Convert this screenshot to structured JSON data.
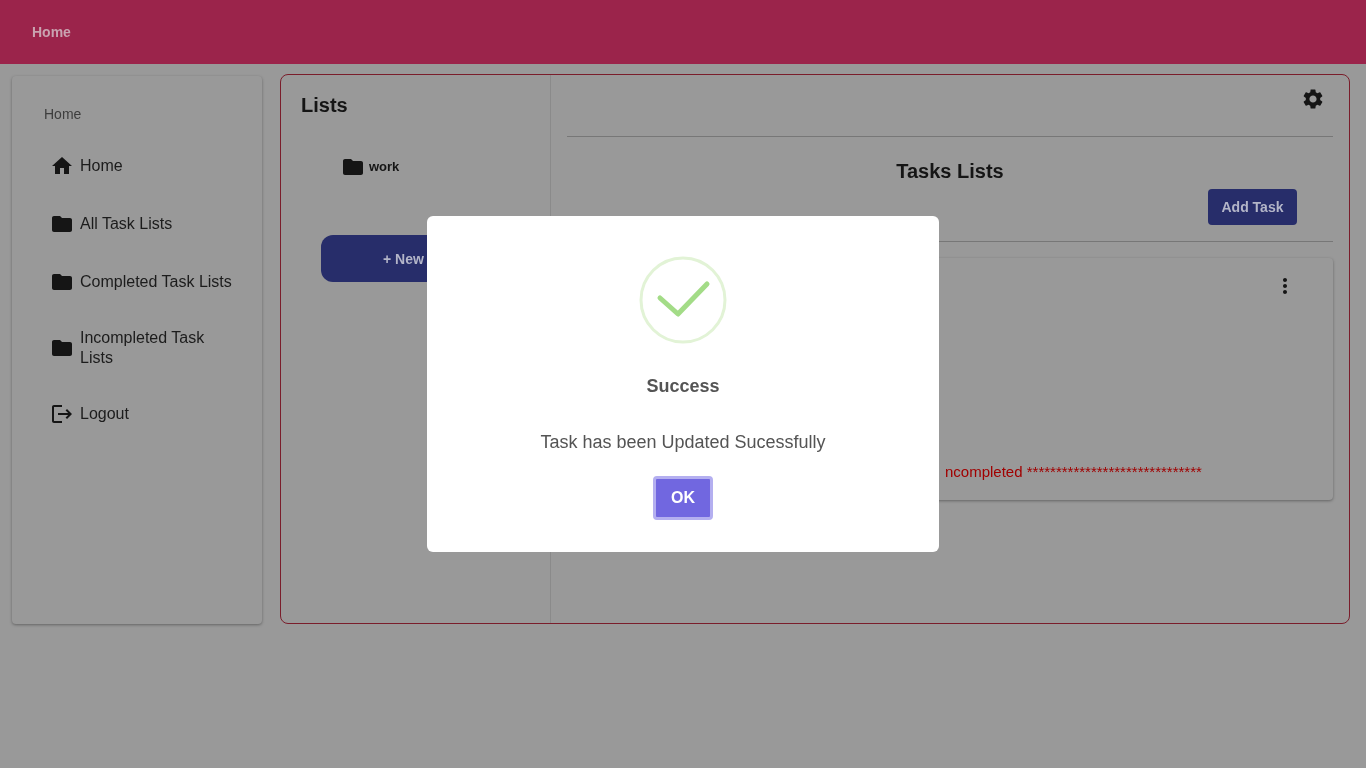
{
  "header": {
    "title": "Home"
  },
  "sidebar": {
    "heading": "Home",
    "items": [
      {
        "kind": "home",
        "label": "Home"
      },
      {
        "kind": "folder",
        "label": "All Task Lists"
      },
      {
        "kind": "folder",
        "label": "Completed Task Lists"
      },
      {
        "kind": "folder",
        "label": "Incompleted Task Lists"
      },
      {
        "kind": "logout",
        "label": "Logout"
      }
    ]
  },
  "lists": {
    "title": "Lists",
    "items": [
      {
        "label": "work"
      }
    ],
    "new_button": "+ New"
  },
  "tasks": {
    "title": "Tasks Lists",
    "add_button": "Add Task",
    "card": {
      "status_text": "ncompleted ******************************"
    }
  },
  "dialog": {
    "title": "Success",
    "message": "Task has been Updated Sucessfully",
    "button": "OK"
  }
}
